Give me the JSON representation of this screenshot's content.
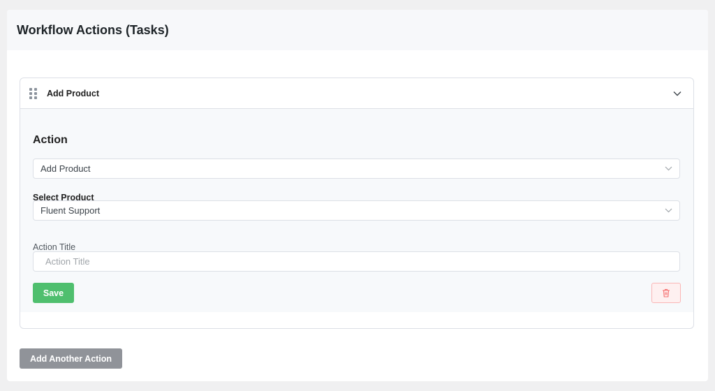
{
  "header": {
    "title": "Workflow Actions (Tasks)"
  },
  "card": {
    "title": "Add Product",
    "section_title": "Action",
    "action_select": {
      "value": "Add Product"
    },
    "product_label": "Select Product",
    "product_select": {
      "value": "Fluent Support"
    },
    "action_title_label": "Action Title",
    "action_title_input": {
      "value": "",
      "placeholder": "Action Title"
    },
    "save_label": "Save"
  },
  "footer": {
    "add_label": "Add Another Action"
  },
  "icons": {
    "drag": "drag-handle-icon",
    "collapse": "chevron-down-icon",
    "select": "chevron-down-icon",
    "delete": "trash-icon"
  },
  "colors": {
    "save": "#4fbf6e",
    "delete_border": "#fab6b6",
    "delete_icon": "#f56c6c",
    "add_button": "#909399"
  }
}
